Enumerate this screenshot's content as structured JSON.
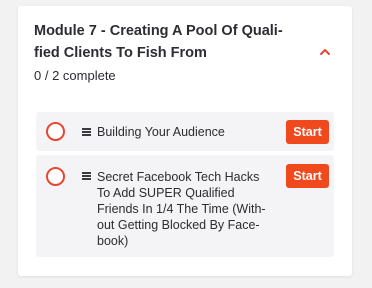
{
  "module": {
    "title": "Module 7 - Creating A Pool Of Quali-\nfied Clients To Fish From",
    "progress": "0 / 2 complete",
    "collapse_icon": "chevron-up-icon",
    "accent_color": "#e8472f"
  },
  "lessons": [
    {
      "title": "Building Your Audience",
      "type_icon": "text-lines-icon",
      "status_icon": "empty-circle-icon",
      "action_label": "Start"
    },
    {
      "title": "Secret Facebook Tech Hacks\nTo Add SUPER Qualified\nFriends In 1/4 The Time (With-\nout Getting Blocked By Face-\nbook)",
      "type_icon": "text-lines-icon",
      "status_icon": "empty-circle-icon",
      "action_label": "Start"
    }
  ],
  "colors": {
    "button_bg": "#f0491e",
    "row_bg": "#f4f4f6",
    "text": "#2c2c31",
    "page_bg": "#f2f2f3"
  }
}
